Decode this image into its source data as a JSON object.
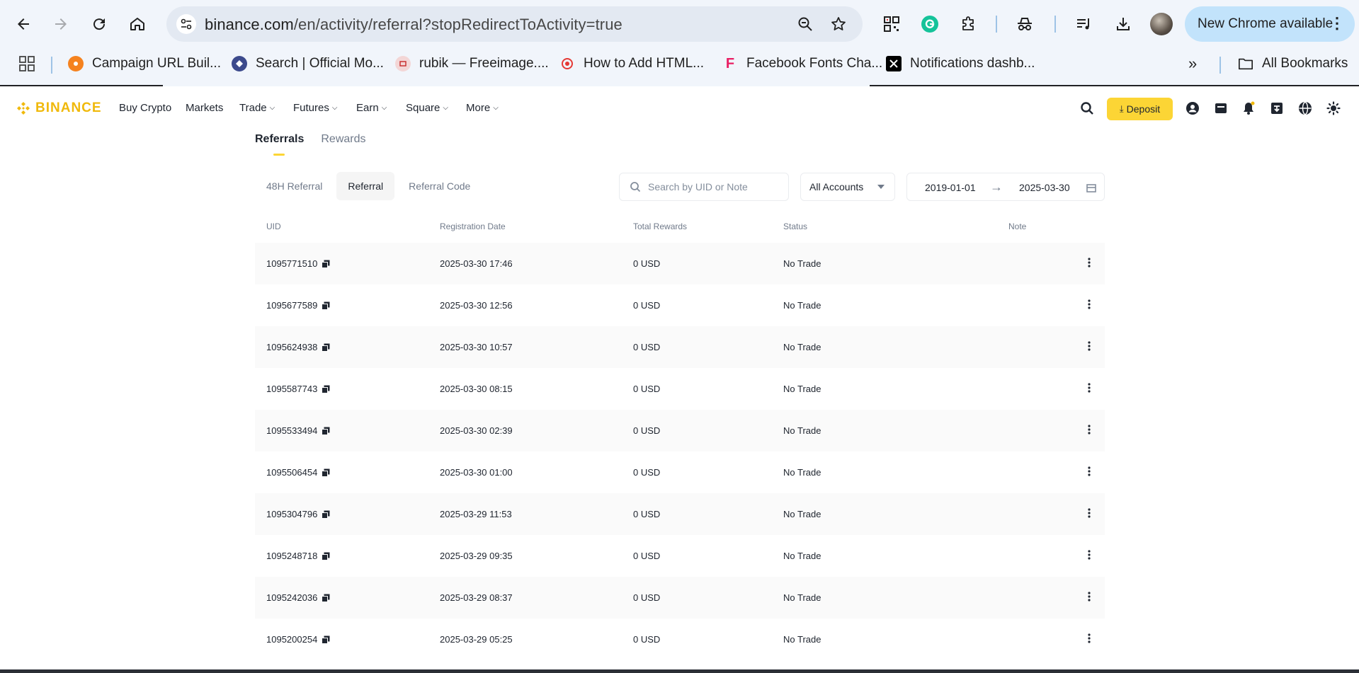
{
  "browser": {
    "url_host": "binance.com",
    "url_path": "/en/activity/referral?stopRedirectToActivity=true",
    "update_label": "New Chrome available",
    "bookmarks": [
      {
        "label": "Campaign URL Buil...",
        "icon": "campaign-favicon"
      },
      {
        "label": "Search | Official Mo...",
        "icon": "search-favicon"
      },
      {
        "label": "rubik — Freeimage....",
        "icon": "freeimage-favicon"
      },
      {
        "label": "How to Add HTML...",
        "icon": "html-favicon"
      },
      {
        "label": "Facebook Fonts Cha...",
        "icon": "facebook-fonts-favicon"
      },
      {
        "label": "Notifications dashb...",
        "icon": "x-favicon"
      }
    ],
    "all_bookmarks_label": "All Bookmarks"
  },
  "header": {
    "logo_text": "BINANCE",
    "nav": [
      {
        "label": "Buy Crypto",
        "dropdown": false
      },
      {
        "label": "Markets",
        "dropdown": false
      },
      {
        "label": "Trade",
        "dropdown": true
      },
      {
        "label": "Futures",
        "dropdown": true
      },
      {
        "label": "Earn",
        "dropdown": true
      },
      {
        "label": "Square",
        "dropdown": true
      },
      {
        "label": "More",
        "dropdown": true
      }
    ],
    "deposit_label": "Deposit",
    "brand_color": "#F0B90B",
    "deposit_color": "#FCD535"
  },
  "page": {
    "tabs": [
      {
        "label": "Referrals",
        "active": true
      },
      {
        "label": "Rewards",
        "active": false
      }
    ],
    "subtabs": [
      {
        "label": "48H Referral",
        "active": false
      },
      {
        "label": "Referral",
        "active": true
      },
      {
        "label": "Referral Code",
        "active": false
      }
    ],
    "search_placeholder": "Search by UID or Note",
    "account_filter": "All Accounts",
    "date_from": "2019-01-01",
    "date_to": "2025-03-30"
  },
  "table": {
    "columns": [
      "UID",
      "Registration Date",
      "Total Rewards",
      "Status",
      "Note"
    ],
    "rows": [
      {
        "uid": "1095771510",
        "date": "2025-03-30 17:46",
        "rewards": "0 USD",
        "status": "No Trade"
      },
      {
        "uid": "1095677589",
        "date": "2025-03-30 12:56",
        "rewards": "0 USD",
        "status": "No Trade"
      },
      {
        "uid": "1095624938",
        "date": "2025-03-30 10:57",
        "rewards": "0 USD",
        "status": "No Trade"
      },
      {
        "uid": "1095587743",
        "date": "2025-03-30 08:15",
        "rewards": "0 USD",
        "status": "No Trade"
      },
      {
        "uid": "1095533494",
        "date": "2025-03-30 02:39",
        "rewards": "0 USD",
        "status": "No Trade"
      },
      {
        "uid": "1095506454",
        "date": "2025-03-30 01:00",
        "rewards": "0 USD",
        "status": "No Trade"
      },
      {
        "uid": "1095304796",
        "date": "2025-03-29 11:53",
        "rewards": "0 USD",
        "status": "No Trade"
      },
      {
        "uid": "1095248718",
        "date": "2025-03-29 09:35",
        "rewards": "0 USD",
        "status": "No Trade"
      },
      {
        "uid": "1095242036",
        "date": "2025-03-29 08:37",
        "rewards": "0 USD",
        "status": "No Trade"
      },
      {
        "uid": "1095200254",
        "date": "2025-03-29 05:25",
        "rewards": "0 USD",
        "status": "No Trade"
      }
    ]
  }
}
